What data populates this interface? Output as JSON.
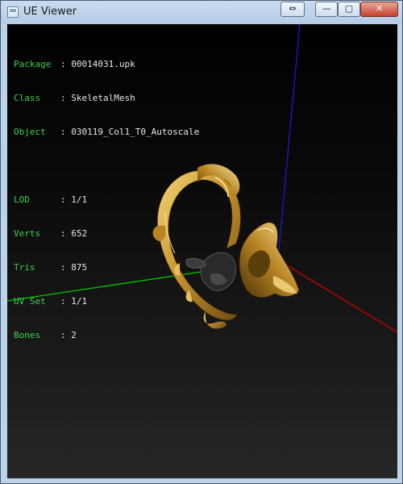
{
  "window": {
    "title": "UE Viewer"
  },
  "titlebar_buttons": {
    "resize": "⇔",
    "minimize": "—",
    "maximize": "▢",
    "close": "✕"
  },
  "info": {
    "package": {
      "label": "Package",
      "value": "00014031.upk"
    },
    "class": {
      "label": "Class",
      "value": "SkeletalMesh"
    },
    "object": {
      "label": "Object",
      "value": "030119_Col1_T0_Autoscale"
    },
    "lod": {
      "label": "LOD",
      "value": "1/1"
    },
    "verts": {
      "label": "Verts",
      "value": "652"
    },
    "tris": {
      "label": "Tris",
      "value": "875"
    },
    "uvset": {
      "label": "UV Set",
      "value": "1/1"
    },
    "bones": {
      "label": "Bones",
      "value": "2"
    }
  },
  "colors": {
    "label_green": "#3ad24a",
    "axis_x": "#cc0000",
    "axis_y": "#00cc00",
    "axis_z": "#1a1ad0",
    "gold": "#c9962e"
  }
}
